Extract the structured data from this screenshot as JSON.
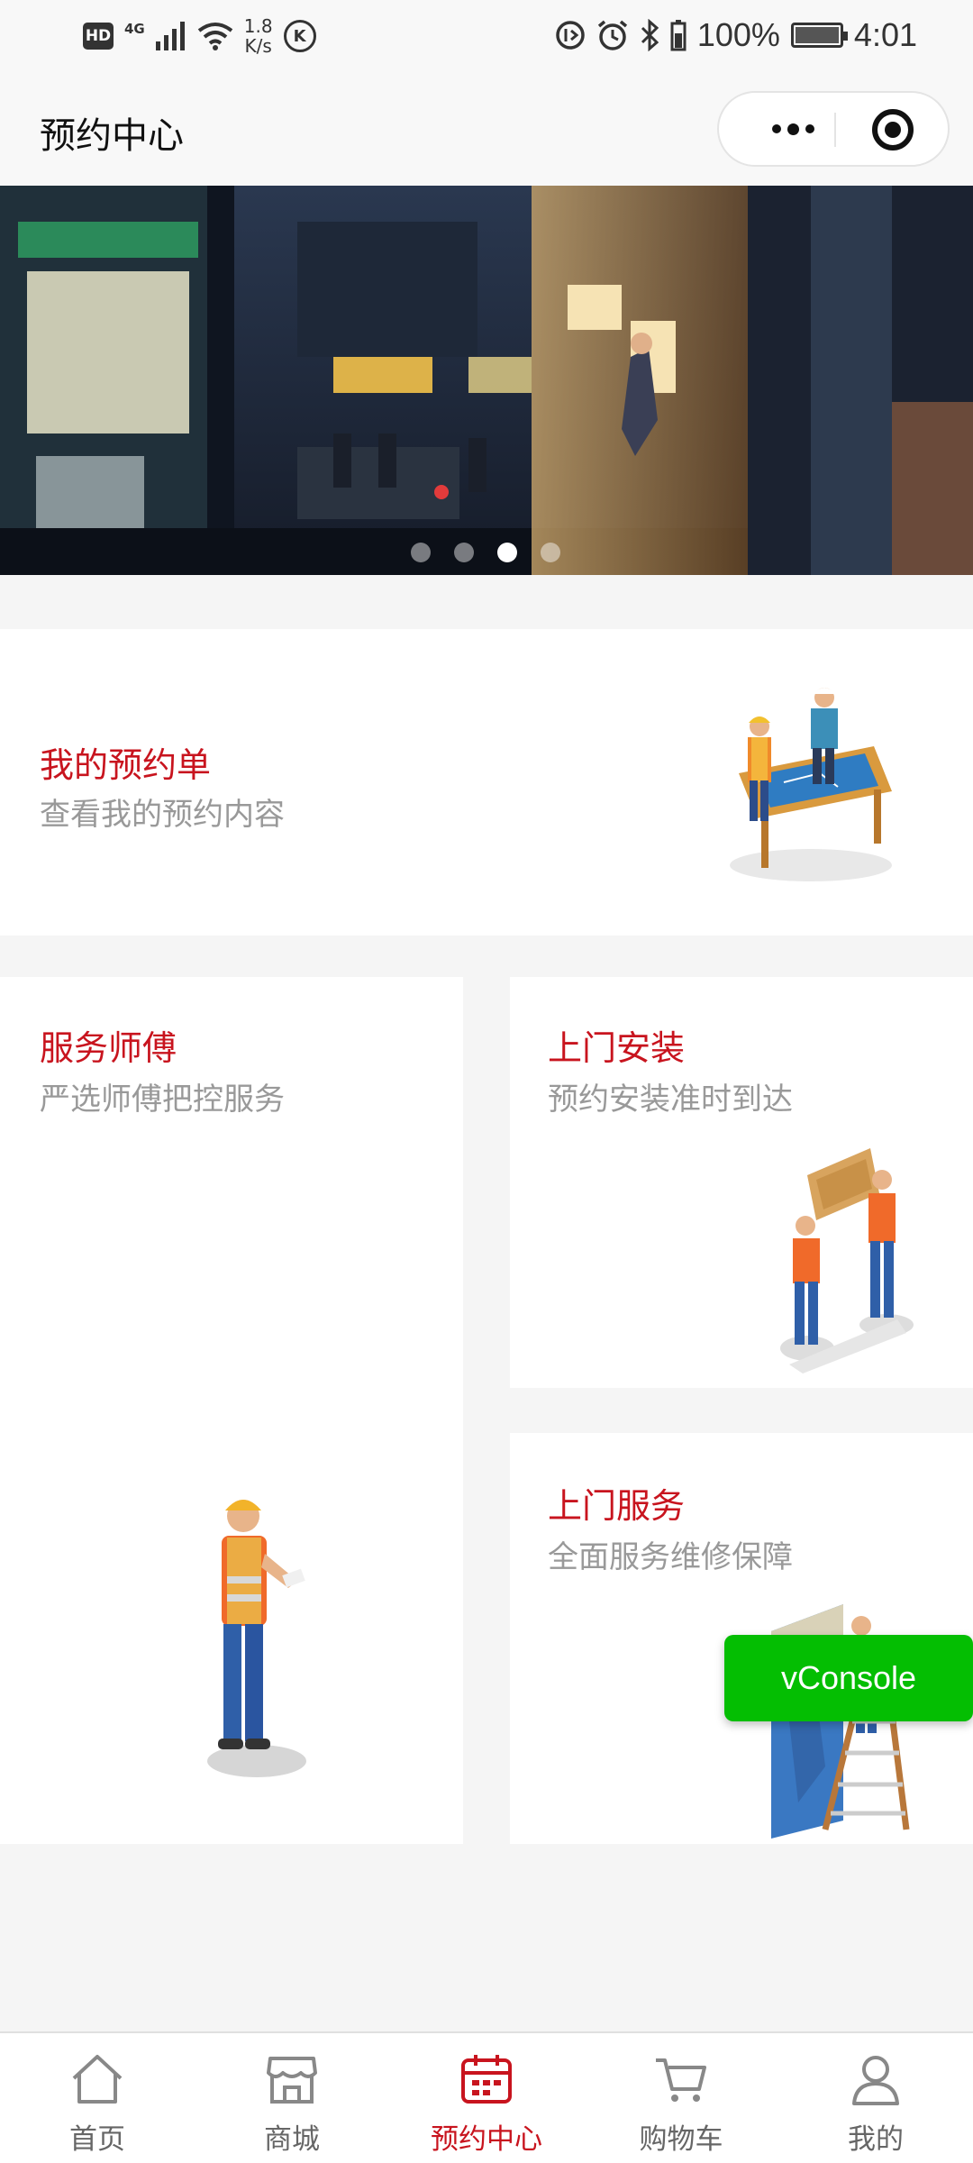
{
  "status_bar": {
    "hd": "HD",
    "network": "4G",
    "speed_value": "1.8",
    "speed_unit": "K/s",
    "k_icon": "K",
    "battery": "100%",
    "time": "4:01"
  },
  "header": {
    "title": "预约中心"
  },
  "banner": {
    "slide_count": 4,
    "active_index": 2
  },
  "cards": {
    "my_orders": {
      "title": "我的预约单",
      "subtitle": "查看我的预约内容"
    },
    "service_master": {
      "title": "服务师傅",
      "subtitle": "严选师傅把控服务"
    },
    "home_install": {
      "title": "上门安装",
      "subtitle": "预约安装准时到达"
    },
    "home_service": {
      "title": "上门服务",
      "subtitle": "全面服务维修保障"
    }
  },
  "vconsole": {
    "label": "vConsole"
  },
  "tabbar": {
    "items": [
      {
        "label": "首页",
        "icon": "home-icon"
      },
      {
        "label": "商城",
        "icon": "store-icon"
      },
      {
        "label": "预约中心",
        "icon": "calendar-icon",
        "active": true
      },
      {
        "label": "购物车",
        "icon": "cart-icon"
      },
      {
        "label": "我的",
        "icon": "user-icon"
      }
    ]
  },
  "colors": {
    "accent": "#c8141e",
    "vconsole": "#04be02",
    "subtitle": "#999999"
  }
}
